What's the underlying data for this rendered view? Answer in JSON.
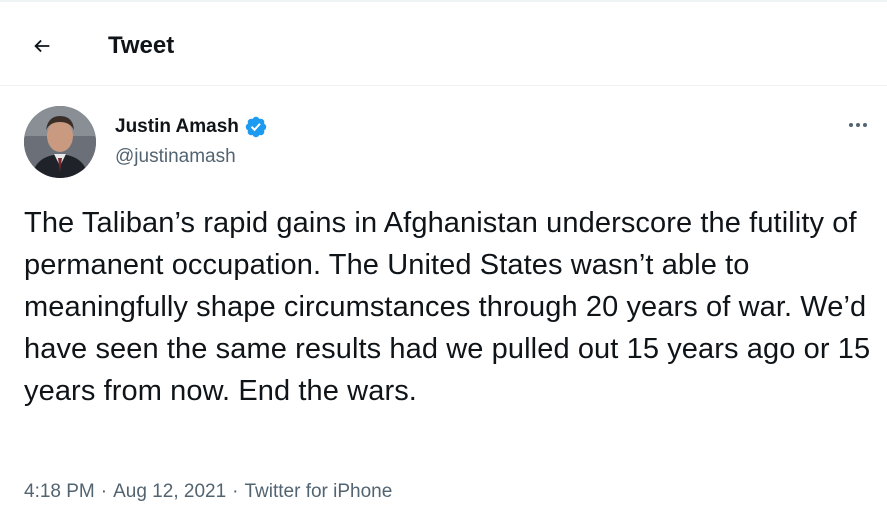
{
  "header": {
    "title": "Tweet"
  },
  "author": {
    "display_name": "Justin Amash",
    "handle": "@justinamash",
    "verified": true
  },
  "tweet": {
    "text": "The Taliban’s rapid gains in Afghanistan underscore the futility of permanent occupation. The United States wasn’t able to meaningfully shape circumstances through 20 years of war. We’d have seen the same results had we pulled out 15 years ago or 15 years from now. End the wars."
  },
  "meta": {
    "time": "4:18 PM",
    "date": "Aug 12, 2021",
    "source": "Twitter for iPhone",
    "separator": "·"
  },
  "icons": {
    "back": "arrow-left-icon",
    "verified": "verified-badge-icon",
    "more": "more-horizontal-icon"
  },
  "colors": {
    "text": "#0f1419",
    "secondary": "#536471",
    "verified": "#1d9bf0",
    "border": "#eff3f4"
  }
}
